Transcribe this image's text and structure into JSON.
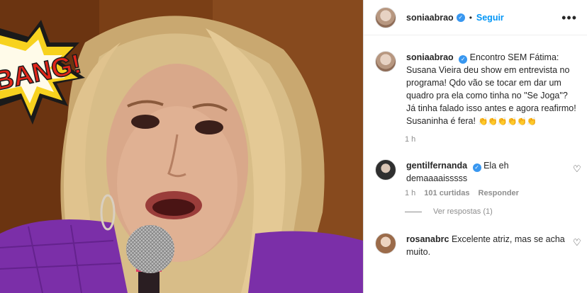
{
  "header": {
    "username": "soniaabrao",
    "verified_icon": "verified-badge-icon",
    "separator": "•",
    "follow_label": "Seguir",
    "more_icon": "more-options-icon"
  },
  "media": {
    "burst_text": "BANG!",
    "description_icon": "photo"
  },
  "caption": {
    "username": "soniaabrao",
    "text": "Encontro SEM Fátima: Susana Vieira deu show em entrevista no programa! Qdo vão se tocar em dar um quadro pra ela como tinha no \"Se Joga\"? Já tinha falado isso antes e agora reafirmo! Susaninha é fera!",
    "emojis": "👏👏👏👏👏👏",
    "time": "1 h"
  },
  "comments": [
    {
      "username": "gentilfernanda",
      "verified": true,
      "text": "Ela eh demaaaaisssss",
      "time": "1 h",
      "likes": "101 curtidas",
      "reply_label": "Responder",
      "view_replies": "Ver respostas (1)"
    },
    {
      "username": "rosanabrc",
      "verified": false,
      "text": "Excelente atriz, mas se acha muito."
    }
  ],
  "colors": {
    "accent": "#0095f6",
    "verified": "#3897f0",
    "muted_text": "#8e8e8e",
    "primary_text": "#262626"
  }
}
